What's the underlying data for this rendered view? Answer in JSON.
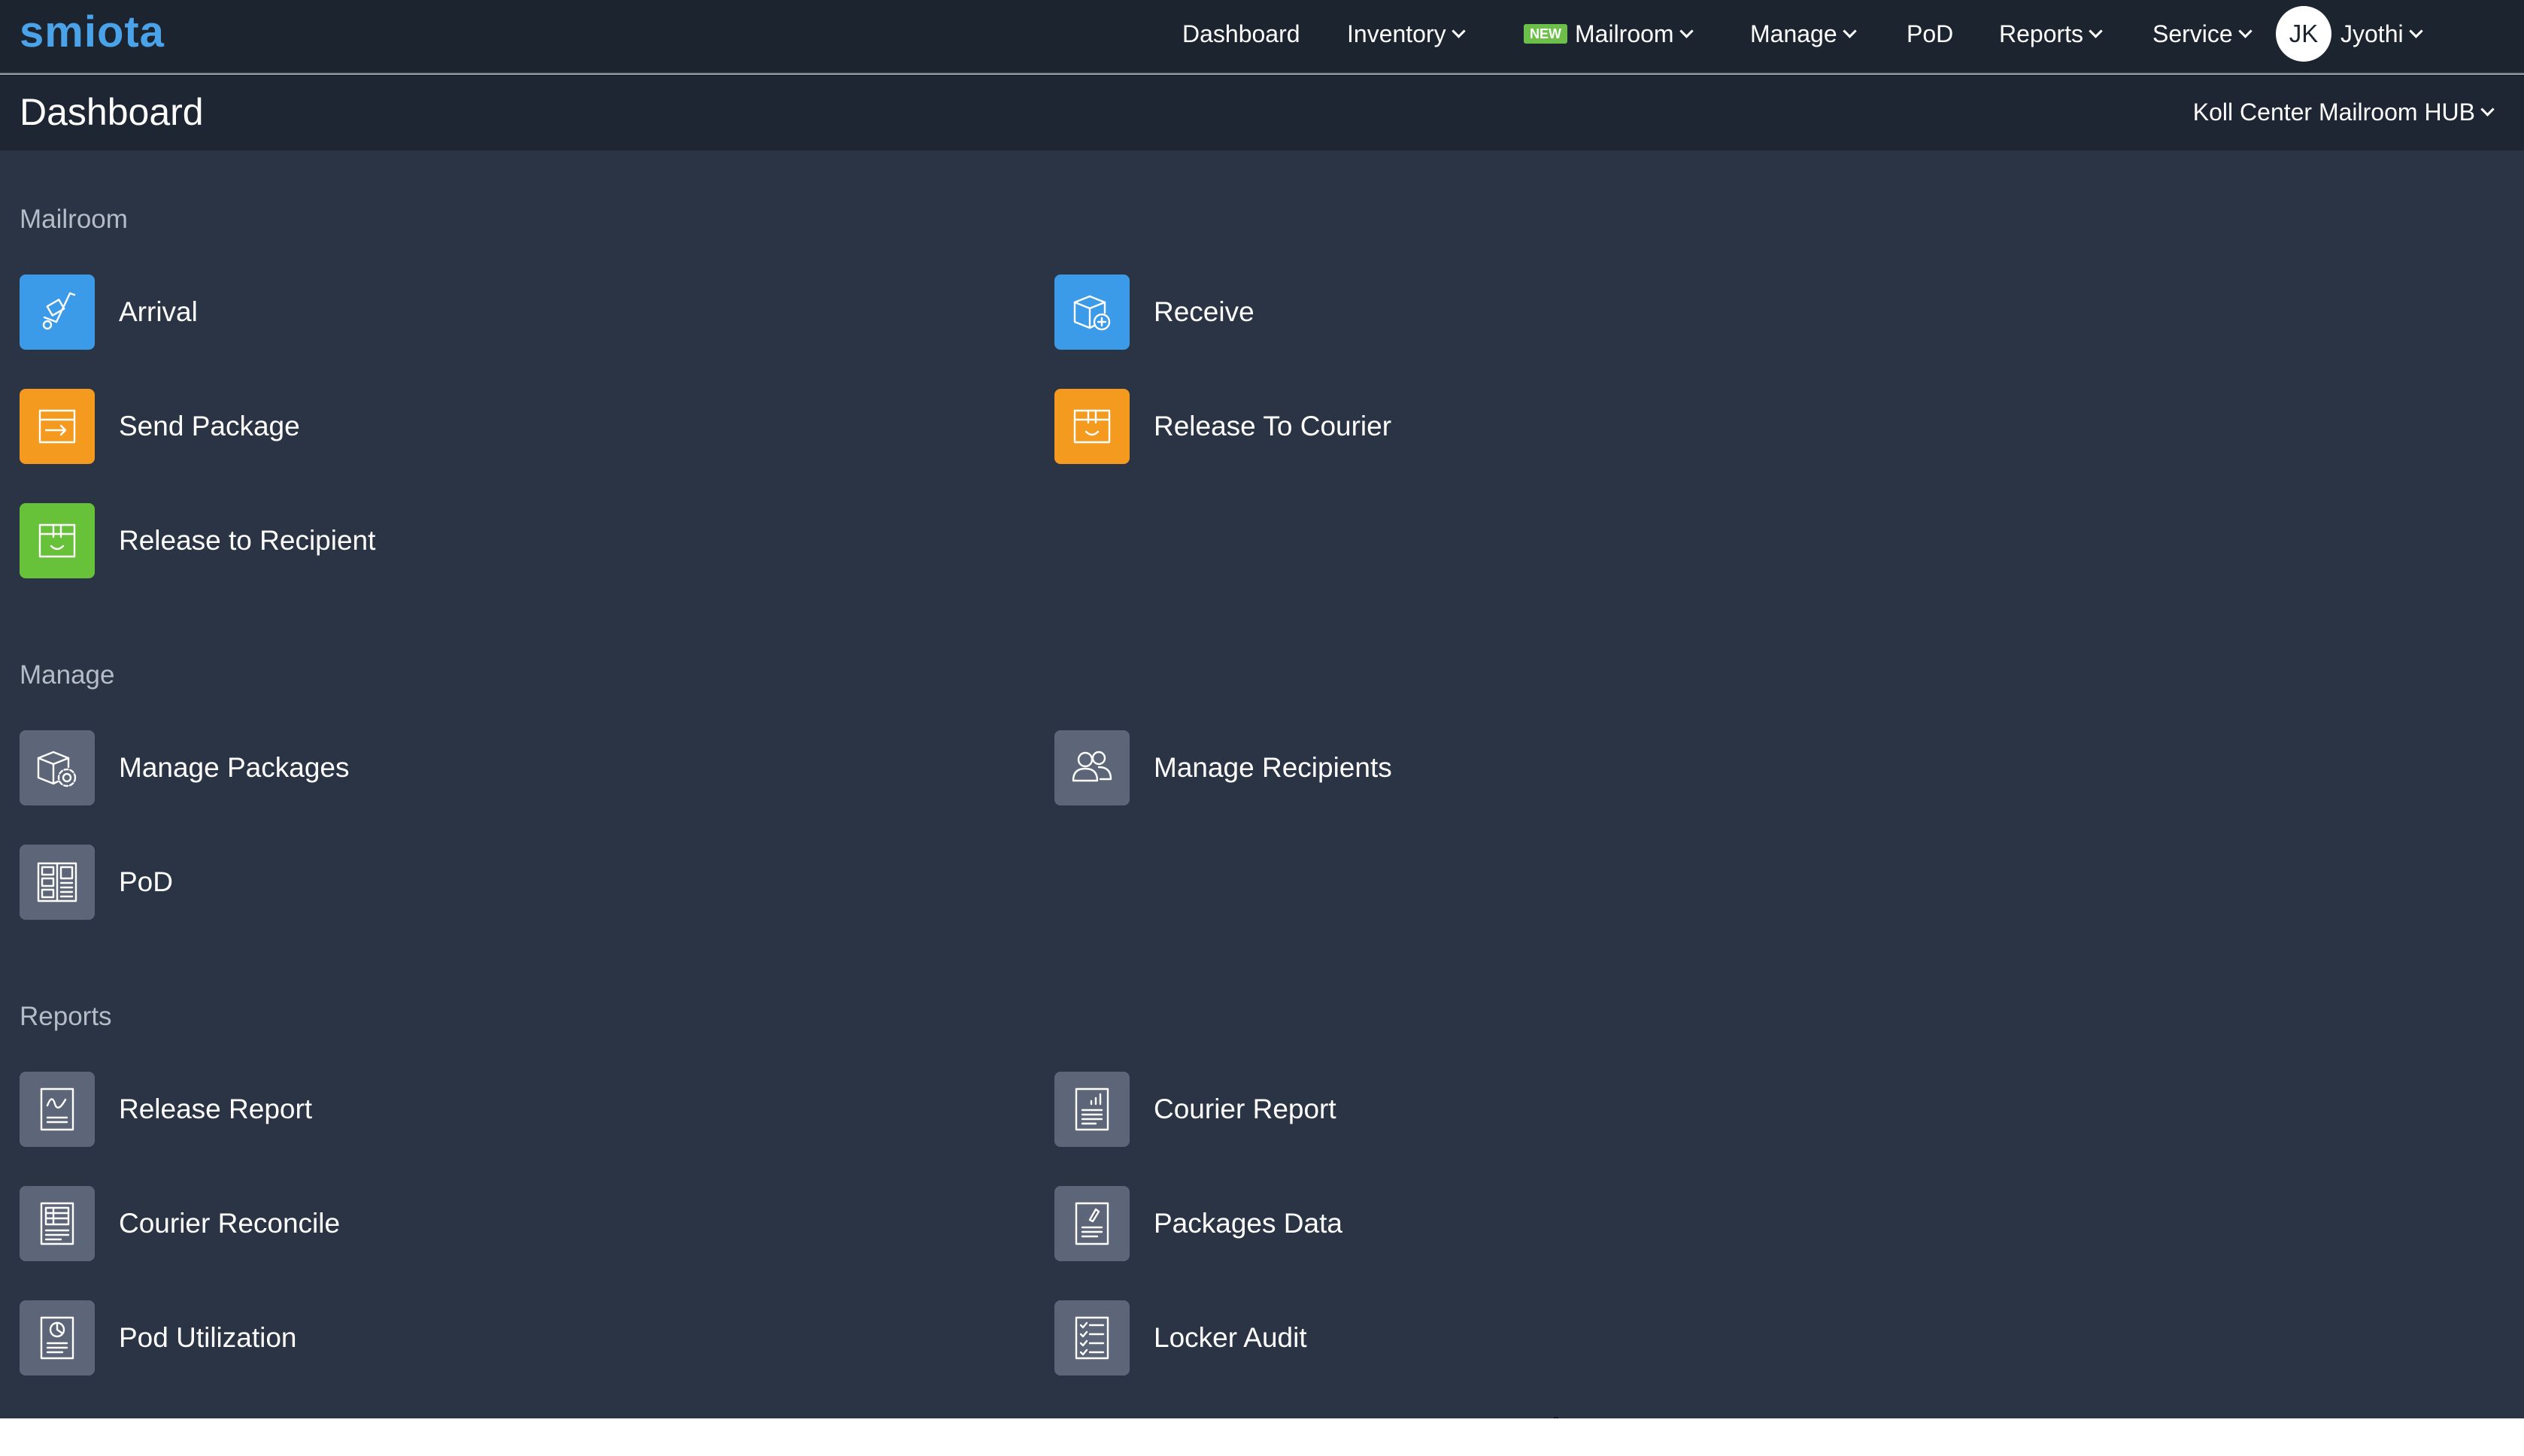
{
  "app": {
    "logo": "smiota"
  },
  "nav": {
    "dashboard": "Dashboard",
    "inventory": "Inventory",
    "new_badge": "NEW",
    "mailroom": "Mailroom",
    "manage": "Manage",
    "pod": "PoD",
    "reports": "Reports",
    "service": "Service",
    "user_initials": "JK",
    "user_name": "Jyothi"
  },
  "header": {
    "title": "Dashboard",
    "location": "Koll Center Mailroom HUB"
  },
  "sections": {
    "mailroom": {
      "title": "Mailroom",
      "tiles": [
        {
          "label": "Arrival",
          "icon": "hand-truck-icon",
          "color": "#3b9be8"
        },
        {
          "label": "Receive",
          "icon": "box-add-icon",
          "color": "#3b9be8"
        },
        {
          "label": "Send Package",
          "icon": "box-send-icon",
          "color": "#f39a1f"
        },
        {
          "label": "Release To Courier",
          "icon": "box-smile-icon",
          "color": "#f39a1f"
        },
        {
          "label": "Release to Recipient",
          "icon": "box-smile-icon",
          "color": "#67c23a"
        }
      ]
    },
    "manage": {
      "title": "Manage",
      "tiles": [
        {
          "label": "Manage Packages",
          "icon": "box-gear-icon",
          "color": "#5d6679"
        },
        {
          "label": "Manage Recipients",
          "icon": "users-icon",
          "color": "#5d6679"
        },
        {
          "label": "PoD",
          "icon": "locker-icon",
          "color": "#5d6679"
        }
      ]
    },
    "reports": {
      "title": "Reports",
      "tiles": [
        {
          "label": "Release Report",
          "icon": "report-signature-icon",
          "color": "#5d6679"
        },
        {
          "label": "Courier Report",
          "icon": "report-chart-icon",
          "color": "#5d6679"
        },
        {
          "label": "Courier Reconcile",
          "icon": "report-table-icon",
          "color": "#5d6679"
        },
        {
          "label": "Packages Data",
          "icon": "report-pen-icon",
          "color": "#5d6679"
        },
        {
          "label": "Pod Utilization",
          "icon": "report-pie-icon",
          "color": "#5d6679"
        },
        {
          "label": "Locker Audit",
          "icon": "report-checklist-icon",
          "color": "#5d6679"
        }
      ]
    }
  }
}
